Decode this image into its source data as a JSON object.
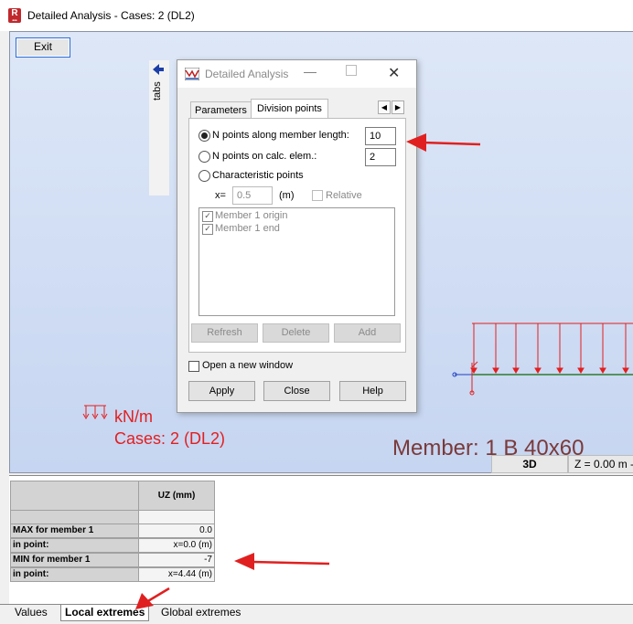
{
  "window": {
    "title": "Detailed Analysis - Cases: 2 (DL2)",
    "app_icon_letter": "R"
  },
  "viewport": {
    "exit_label": "Exit",
    "tabs_label": "tabs",
    "unit_label": "kN/m",
    "cases_label": "Cases: 2 (DL2)",
    "member_label": "Member: 1  B 40x60",
    "view_3d_label": "3D",
    "z_label": "Z = 0.00 m - ..."
  },
  "dialog": {
    "title": "Detailed Analysis",
    "tabs": [
      "Parameters",
      "Division points"
    ],
    "options": [
      {
        "label": "N points along member length:",
        "selected": true,
        "value": "10"
      },
      {
        "label": "N points on calc. elem.:",
        "selected": false,
        "value": "2"
      },
      {
        "label": "Characteristic points",
        "selected": false
      }
    ],
    "x_label": "x=",
    "x_value": "0.5",
    "x_unit": "(m)",
    "relative_label": "Relative",
    "list_items": [
      "Member 1 origin",
      "Member 1 end"
    ],
    "refresh_label": "Refresh",
    "delete_label": "Delete",
    "add_label": "Add",
    "open_new_window_label": "Open a new window",
    "apply_label": "Apply",
    "close_label": "Close",
    "help_label": "Help"
  },
  "table": {
    "column_header": "UZ (mm)",
    "rows": [
      {
        "label": "MAX for member 1",
        "value": "0.0"
      },
      {
        "label": "in point:",
        "value": "x=0.0 (m)"
      },
      {
        "label": "MIN for member 1",
        "value": "-7"
      },
      {
        "label": "in point:",
        "value": "x=4.44 (m)"
      }
    ]
  },
  "bottom_tabs": [
    "Values",
    "Local extremes",
    "Global extremes"
  ],
  "colors": {
    "annotation_arrow": "#e02020",
    "load": "#e21f1f",
    "member_label": "#7a3a3a"
  }
}
